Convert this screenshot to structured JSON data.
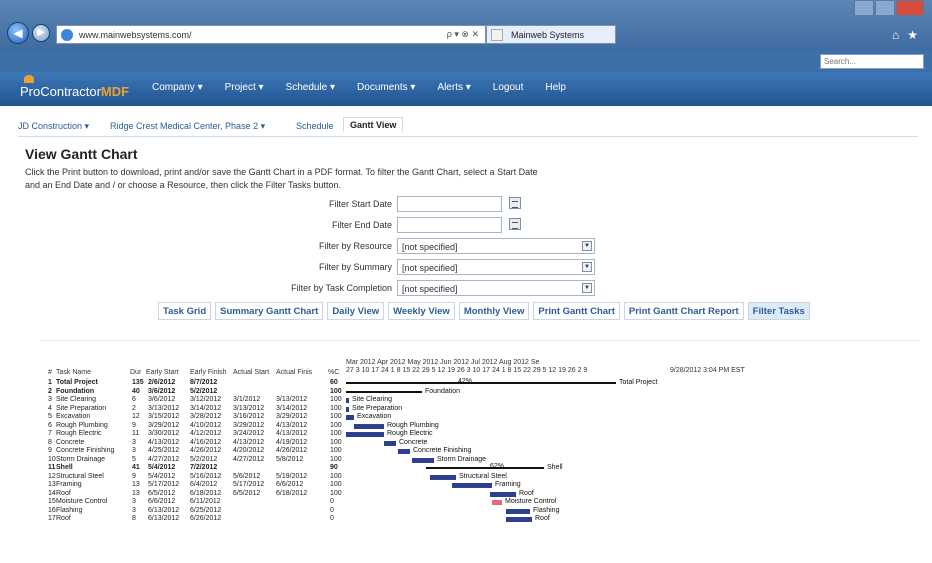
{
  "browser": {
    "url": "www.mainwebsystems.com/",
    "address_controls": "ρ ▾ ⊗ ✕",
    "tab_label": "Mainweb Systems"
  },
  "app": {
    "search_placeholder": "Search...",
    "logo_main": "ProContractor",
    "logo_accent": "MDF",
    "menu": [
      {
        "label": "Company ▾"
      },
      {
        "label": "Project ▾"
      },
      {
        "label": "Schedule ▾"
      },
      {
        "label": "Documents ▾"
      },
      {
        "label": "Alerts ▾"
      },
      {
        "label": "Logout"
      },
      {
        "label": "Help"
      }
    ]
  },
  "breadcrumb": {
    "c1": "JD Construction ▾",
    "c2": "Ridge Crest Medical Center, Phase 2 ▾",
    "c3": "Schedule",
    "c4": "Gantt View"
  },
  "page": {
    "title": "View Gantt Chart",
    "instructions_line1": "Click the Print button to download, print and/or save the Gantt Chart in a PDF format. To filter the Gantt Chart, select a Start Date",
    "instructions_line2": "and an End Date and / or choose a Resource, then click the Filter Tasks button."
  },
  "filters": {
    "start_label": "Filter Start Date",
    "end_label": "Filter End Date",
    "resource_label": "Filter by Resource",
    "resource_value": "[not specified]",
    "summary_label": "Filter by Summary",
    "summary_value": "[not specified]",
    "completion_label": "Filter by Task Completion",
    "completion_value": "[not specified]"
  },
  "toolbar": {
    "task_grid": "Task Grid",
    "summary_gantt": "Summary Gantt Chart",
    "daily_view": "Daily View",
    "weekly_view": "Weekly View",
    "monthly_view": "Monthly View",
    "print_gantt": "Print Gantt Chart",
    "print_gantt_report": "Print Gantt Chart Report",
    "filter_tasks": "Filter Tasks"
  },
  "gantt": {
    "columns": {
      "num": "#",
      "name": "Task Name",
      "dur": "Dur",
      "early_start": "Early Start",
      "early_finish": "Early Finish",
      "actual_start": "Actual Start",
      "actual_finish": "Actual Finis",
      "pct": "%C"
    },
    "months": "Mar 2012      Apr 2012        May 2012    Jun 2012    Jul 2012        Aug 2012    Se",
    "days": "27 3  10 17 24 1  8  15 22 29 5  12 19 26 3  10 17 24 1  8  15 22 29 5  12 19 26 2  9",
    "printed": "9/28/2012 3:04 PM EST",
    "total_label": "Total Project",
    "total_pct": "42%",
    "shell_pct": "62%",
    "tasks": [
      {
        "num": "1",
        "name": "Total Project",
        "dur": "135",
        "es": "2/6/2012",
        "ef": "8/7/2012",
        "as": "",
        "af": "",
        "pct": "60",
        "bold": true
      },
      {
        "num": "2",
        "name": "Foundation",
        "dur": "40",
        "es": "3/6/2012",
        "ef": "5/2/2012",
        "as": "",
        "af": "",
        "pct": "100",
        "bold": true
      },
      {
        "num": "3",
        "name": "Site Clearing",
        "dur": "6",
        "es": "3/6/2012",
        "ef": "3/12/2012",
        "as": "3/1/2012",
        "af": "3/13/2012",
        "pct": "100",
        "bold": false
      },
      {
        "num": "4",
        "name": "Site Preparation",
        "dur": "2",
        "es": "3/13/2012",
        "ef": "3/14/2012",
        "as": "3/13/2012",
        "af": "3/14/2012",
        "pct": "100",
        "bold": false
      },
      {
        "num": "5",
        "name": "Excavation",
        "dur": "12",
        "es": "3/15/2012",
        "ef": "3/28/2012",
        "as": "3/16/2012",
        "af": "3/29/2012",
        "pct": "100",
        "bold": false
      },
      {
        "num": "6",
        "name": "Rough Plumbing",
        "dur": "9",
        "es": "3/29/2012",
        "ef": "4/10/2012",
        "as": "3/29/2012",
        "af": "4/13/2012",
        "pct": "100",
        "bold": false
      },
      {
        "num": "7",
        "name": "Rough Electric",
        "dur": "11",
        "es": "3/30/2012",
        "ef": "4/12/2012",
        "as": "3/24/2012",
        "af": "4/13/2012",
        "pct": "100",
        "bold": false
      },
      {
        "num": "8",
        "name": "Concrete",
        "dur": "3",
        "es": "4/13/2012",
        "ef": "4/16/2012",
        "as": "4/13/2012",
        "af": "4/19/2012",
        "pct": "100",
        "bold": false
      },
      {
        "num": "9",
        "name": "Concrete Finishing",
        "dur": "3",
        "es": "4/25/2012",
        "ef": "4/26/2012",
        "as": "4/20/2012",
        "af": "4/26/2012",
        "pct": "100",
        "bold": false
      },
      {
        "num": "10",
        "name": "Storm Drainage",
        "dur": "5",
        "es": "4/27/2012",
        "ef": "5/2/2012",
        "as": "4/27/2012",
        "af": "5/8/2012",
        "pct": "100",
        "bold": false
      },
      {
        "num": "11",
        "name": "Shell",
        "dur": "41",
        "es": "5/4/2012",
        "ef": "7/2/2012",
        "as": "",
        "af": "",
        "pct": "90",
        "bold": true
      },
      {
        "num": "12",
        "name": "Structural Steel",
        "dur": "9",
        "es": "5/4/2012",
        "ef": "5/16/2012",
        "as": "5/6/2012",
        "af": "5/19/2012",
        "pct": "100",
        "bold": false
      },
      {
        "num": "13",
        "name": "Framing",
        "dur": "13",
        "es": "5/17/2012",
        "ef": "6/4/2012",
        "as": "5/17/2012",
        "af": "6/6/2012",
        "pct": "100",
        "bold": false
      },
      {
        "num": "14",
        "name": "Roof",
        "dur": "13",
        "es": "6/5/2012",
        "ef": "6/18/2012",
        "as": "6/5/2012",
        "af": "6/18/2012",
        "pct": "100",
        "bold": false
      },
      {
        "num": "15",
        "name": "Moisture Control",
        "dur": "3",
        "es": "6/6/2012",
        "ef": "6/11/2012",
        "as": "",
        "af": "",
        "pct": "0",
        "bold": false
      },
      {
        "num": "16",
        "name": "Flashing",
        "dur": "3",
        "es": "6/13/2012",
        "ef": "6/25/2012",
        "as": "",
        "af": "",
        "pct": "0",
        "bold": false
      },
      {
        "num": "17",
        "name": "Roof",
        "dur": "8",
        "es": "6/13/2012",
        "ef": "6/26/2012",
        "as": "",
        "af": "",
        "pct": "0",
        "bold": false
      }
    ]
  }
}
